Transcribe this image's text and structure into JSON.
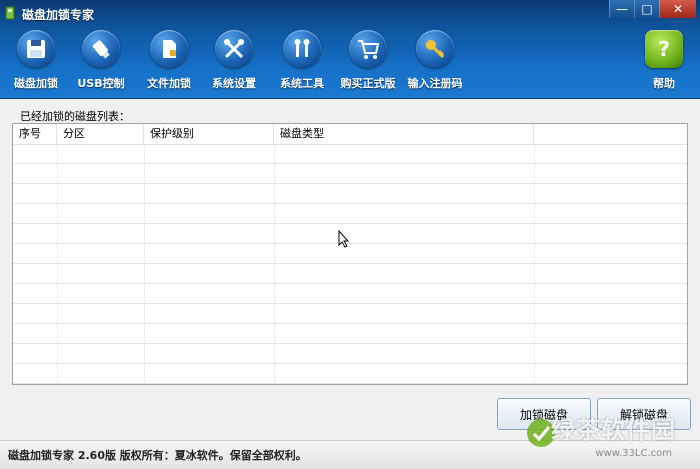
{
  "window": {
    "title": "磁盘加锁专家",
    "controls": {
      "minimize": "—",
      "maximize": "□",
      "close": "✕"
    }
  },
  "toolbar": {
    "items": [
      {
        "label": "磁盘加锁",
        "icon": "floppy-disk-icon"
      },
      {
        "label": "USB控制",
        "icon": "usb-drive-icon"
      },
      {
        "label": "文件加锁",
        "icon": "document-icon"
      },
      {
        "label": "系统设置",
        "icon": "tools-icon"
      },
      {
        "label": "系统工具",
        "icon": "wrench-icon"
      },
      {
        "label": "购买正式版",
        "icon": "shopping-cart-icon"
      },
      {
        "label": "输入注册码",
        "icon": "key-icon"
      }
    ],
    "help": {
      "label": "帮助",
      "icon": "help-icon",
      "glyph": "?"
    }
  },
  "list": {
    "caption": "已经加锁的磁盘列表：",
    "columns": [
      "序号",
      "分区",
      "保护级别",
      "磁盘类型"
    ],
    "rows": []
  },
  "buttons": {
    "lock_disk": "加锁磁盘",
    "unlock_disk": "解锁磁盘"
  },
  "status": {
    "text": "磁盘加锁专家 2.60版  版权所有：夏冰软件。保留全部权利。"
  },
  "watermark": {
    "text": "绿茶软件园",
    "url": "www.33LC.com"
  },
  "colors": {
    "toolbar_gradient_top": "#0b3a74",
    "toolbar_gradient_bottom": "#1c79d0",
    "help_icon_green": "#6fb21c"
  }
}
